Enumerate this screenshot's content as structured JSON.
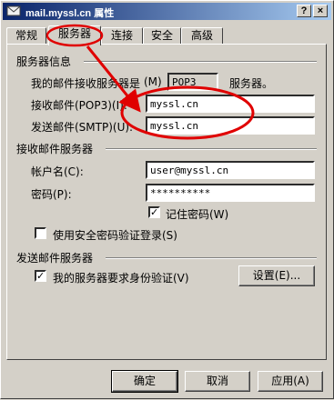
{
  "window": {
    "title": "mail.myssl.cn 属性",
    "help_label": "?",
    "close_label": "×"
  },
  "tabs": [
    {
      "label": "常规"
    },
    {
      "label": "服务器",
      "active": true
    },
    {
      "label": "连接"
    },
    {
      "label": "安全"
    },
    {
      "label": "高级"
    }
  ],
  "server_info": {
    "group_title": "服务器信息",
    "incoming_type_prefix": "我的邮件接收服务器是",
    "incoming_type_accel": "(M)",
    "incoming_type_value": "POP3",
    "incoming_type_suffix": "服务器。",
    "pop3_label": "接收邮件(POP3)(I):",
    "pop3_value": "myssl.cn",
    "smtp_label": "发送邮件(SMTP)(U):",
    "smtp_value": "myssl.cn"
  },
  "incoming_server": {
    "group_title": "接收邮件服务器",
    "account_label": "帐户名(C):",
    "account_value": "user@myssl.cn",
    "password_label": "密码(P):",
    "password_value": "**********",
    "remember_label": "记住密码(W)",
    "remember_checked": true,
    "spa_label": "使用安全密码验证登录(S)",
    "spa_checked": false
  },
  "outgoing_server": {
    "group_title": "发送邮件服务器",
    "auth_label": "我的服务器要求身份验证(V)",
    "auth_checked": true,
    "settings_label": "设置(E)..."
  },
  "footer": {
    "ok_label": "确定",
    "cancel_label": "取消",
    "apply_label": "应用(A)"
  },
  "annotation_color": "#e00000"
}
